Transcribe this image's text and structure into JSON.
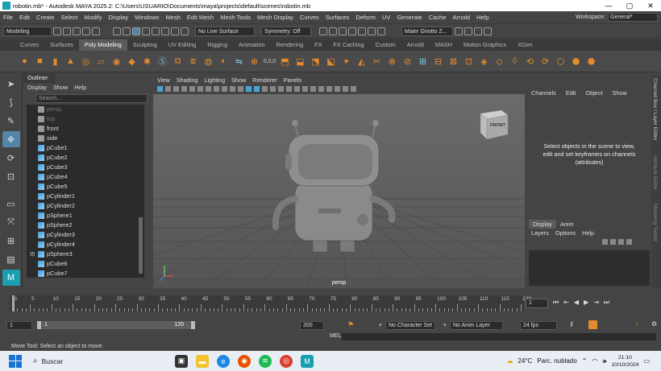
{
  "window": {
    "title": "robotin.mb* - Autodesk MAYA 2025.2: C:\\Users\\USUARIO\\Documents\\maya\\projects\\default\\scenes\\robotin.mb",
    "min_glyph": "—",
    "max_glyph": "▢",
    "close_glyph": "✕"
  },
  "menubar": {
    "items": [
      "File",
      "Edit",
      "Create",
      "Select",
      "Modify",
      "Display",
      "Windows",
      "Mesh",
      "Edit Mesh",
      "Mesh Tools",
      "Mesh Display",
      "Curves",
      "Surfaces",
      "Deform",
      "UV",
      "Generate",
      "Cache",
      "Arnold",
      "Help"
    ],
    "workspace_label": "Workspace:",
    "workspace_value": "General*"
  },
  "statusline": {
    "mode": "Modeling",
    "live_surface": "No Live Surface",
    "symmetry": "Symmetry: Off",
    "user": "Maier Girotto Z...",
    "coord_readout": "0,0,0"
  },
  "shelf_tabs": {
    "items": [
      "Curves",
      "Surfaces",
      "Poly Modeling",
      "Sculpting",
      "UV Editing",
      "Rigging",
      "Animation",
      "Rendering",
      "FX",
      "FX Caching",
      "Custom",
      "Arnold",
      "MASH",
      "Motion Graphics",
      "XGen"
    ],
    "active": "Poly Modeling"
  },
  "outliner": {
    "title": "Outliner",
    "menu": [
      "Display",
      "Show",
      "Help"
    ],
    "search_placeholder": "Search...",
    "items": [
      {
        "name": "persp",
        "type": "camera",
        "dim": true,
        "expandable": false
      },
      {
        "name": "top",
        "type": "camera",
        "dim": true,
        "expandable": false
      },
      {
        "name": "front",
        "type": "camera",
        "dim": false,
        "expandable": false
      },
      {
        "name": "side",
        "type": "camera",
        "dim": false,
        "expandable": false
      },
      {
        "name": "pCube1",
        "type": "mesh",
        "dim": false,
        "expandable": false
      },
      {
        "name": "pCube2",
        "type": "mesh",
        "dim": false,
        "expandable": false
      },
      {
        "name": "pCube3",
        "type": "mesh",
        "dim": false,
        "expandable": false
      },
      {
        "name": "pCube4",
        "type": "mesh",
        "dim": false,
        "expandable": false
      },
      {
        "name": "pCube5",
        "type": "mesh",
        "dim": false,
        "expandable": false
      },
      {
        "name": "pCylinder1",
        "type": "mesh",
        "dim": false,
        "expandable": false
      },
      {
        "name": "pCylinder2",
        "type": "mesh",
        "dim": false,
        "expandable": false
      },
      {
        "name": "pSphere1",
        "type": "mesh",
        "dim": false,
        "expandable": false
      },
      {
        "name": "pSphere2",
        "type": "mesh",
        "dim": false,
        "expandable": false
      },
      {
        "name": "pCylinder3",
        "type": "mesh",
        "dim": false,
        "expandable": false
      },
      {
        "name": "pCylinder4",
        "type": "mesh",
        "dim": false,
        "expandable": false
      },
      {
        "name": "pSphere3",
        "type": "mesh",
        "dim": false,
        "expandable": true
      },
      {
        "name": "pCube6",
        "type": "mesh",
        "dim": false,
        "expandable": false
      },
      {
        "name": "pCube7",
        "type": "mesh",
        "dim": false,
        "expandable": false
      }
    ]
  },
  "viewport": {
    "menu": [
      "View",
      "Shading",
      "Lighting",
      "Show",
      "Renderer",
      "Panels"
    ],
    "camera_label": "persp",
    "viewcube_label": "FRONT"
  },
  "channel_box": {
    "menu": [
      "Channels",
      "Edit",
      "Object",
      "Show"
    ],
    "message": "Select objects in the scene to view, edit and set keyframes on channels (attributes)",
    "display_tabs": [
      "Display",
      "Anim"
    ],
    "active_tab": "Display",
    "layer_menu": [
      "Layers",
      "Options",
      "Help"
    ],
    "side_tabs": [
      "Channel Box / Layer Editor",
      "Attribute Editor",
      "Modeling Toolkit"
    ]
  },
  "timeline": {
    "ticks": [
      1,
      5,
      10,
      15,
      20,
      25,
      30,
      35,
      40,
      45,
      50,
      55,
      60,
      65,
      70,
      75,
      80,
      85,
      90,
      95,
      100,
      105,
      110,
      115,
      120
    ],
    "current_frame": "1",
    "controls": [
      "⏮",
      "⇤",
      "◀",
      "▶",
      "⇥",
      "⏭"
    ]
  },
  "range": {
    "start": "1",
    "inner_start": "1",
    "inner_end": "120",
    "end": "200",
    "character_set": "No Character Set",
    "anim_layer": "No Anim Layer",
    "fps": "24 fps"
  },
  "cmd": {
    "mel": "MEL",
    "help_text": "Move Tool: Select an object to move."
  },
  "taskbar": {
    "search": "Buscar",
    "weather_temp": "24°C",
    "weather_text": "Parc. nublado",
    "time": "21:10",
    "date": "10/10/2024"
  },
  "colors": {
    "accent": "#5285a6",
    "panel": "#444444",
    "field": "#2b2b2b",
    "shelf_icon": "#e58b2d"
  }
}
